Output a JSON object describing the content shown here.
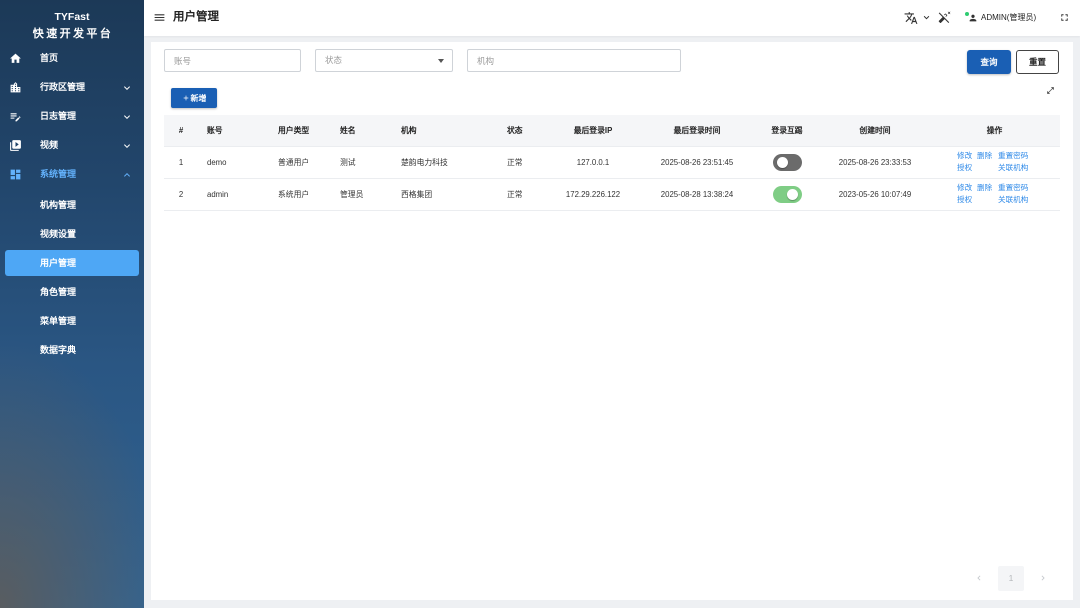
{
  "sidebar": {
    "brand": "TYFast",
    "subtitle": "快速开发平台",
    "menu": [
      {
        "label": "首页",
        "icon": "home-icon"
      },
      {
        "label": "行政区管理",
        "icon": "buildings-icon",
        "expanded": false
      },
      {
        "label": "日志管理",
        "icon": "edit-note-icon",
        "expanded": false
      },
      {
        "label": "视频",
        "icon": "video-icon",
        "expanded": false
      },
      {
        "label": "系统管理",
        "icon": "dashboard-icon",
        "expanded": true,
        "children": [
          {
            "label": "机构管理",
            "active": false
          },
          {
            "label": "视频设置",
            "active": false
          },
          {
            "label": "用户管理",
            "active": true
          },
          {
            "label": "角色管理",
            "active": false
          },
          {
            "label": "菜单管理",
            "active": false
          },
          {
            "label": "数据字典",
            "active": false
          }
        ]
      }
    ]
  },
  "header": {
    "title": "用户管理",
    "user_name": "ADMIN(管理员)",
    "user_online": true,
    "icons": [
      "menu-icon",
      "translate-icon",
      "chevron-down-icon",
      "auto-fix-off-icon",
      "account-icon",
      "fullscreen-icon"
    ]
  },
  "search": {
    "account": {
      "placeholder": "账号",
      "value": ""
    },
    "status": {
      "placeholder": "状态",
      "value": ""
    },
    "organization": {
      "placeholder": "机构",
      "value": ""
    },
    "query_label": "查询",
    "reset_label": "重置"
  },
  "toolbar": {
    "add_label": "新增",
    "add_icon": "plus-icon",
    "expand_icon": "expand-icon"
  },
  "table": {
    "columns": [
      "#",
      "账号",
      "用户类型",
      "姓名",
      "机构",
      "状态",
      "最后登录IP",
      "最后登录时间",
      "登录互踢",
      "创建时间",
      "操作"
    ],
    "rows": [
      {
        "index": "1",
        "account": "demo",
        "user_type": "普通用户",
        "name": "测试",
        "organization": "楚韵电力科技",
        "status": "正常",
        "last_login_ip": "127.0.0.1",
        "last_login_time": "2025-08-26 23:51:45",
        "login_kick": false,
        "created_at": "2025-08-26 23:33:53"
      },
      {
        "index": "2",
        "account": "admin",
        "user_type": "系统用户",
        "name": "管理员",
        "organization": "西格集团",
        "status": "正常",
        "last_login_ip": "172.29.226.122",
        "last_login_time": "2025-08-28 13:38:24",
        "login_kick": true,
        "created_at": "2023-05-26 10:07:49"
      }
    ],
    "actions": [
      "修改",
      "删除",
      "重置密码",
      "授权",
      "关联机构"
    ]
  },
  "pagination": {
    "current_page": "1",
    "prev_disabled": true,
    "next_disabled": true
  },
  "colors": {
    "primary": "#1a5fb4",
    "sidebar_active": "#4ea7f5",
    "menu_highlight": "#63b1fb",
    "link": "#2f8ae8",
    "toggle_on": "#7fcd85",
    "toggle_off": "#6b6b6b",
    "online_dot": "#2ecc71"
  }
}
